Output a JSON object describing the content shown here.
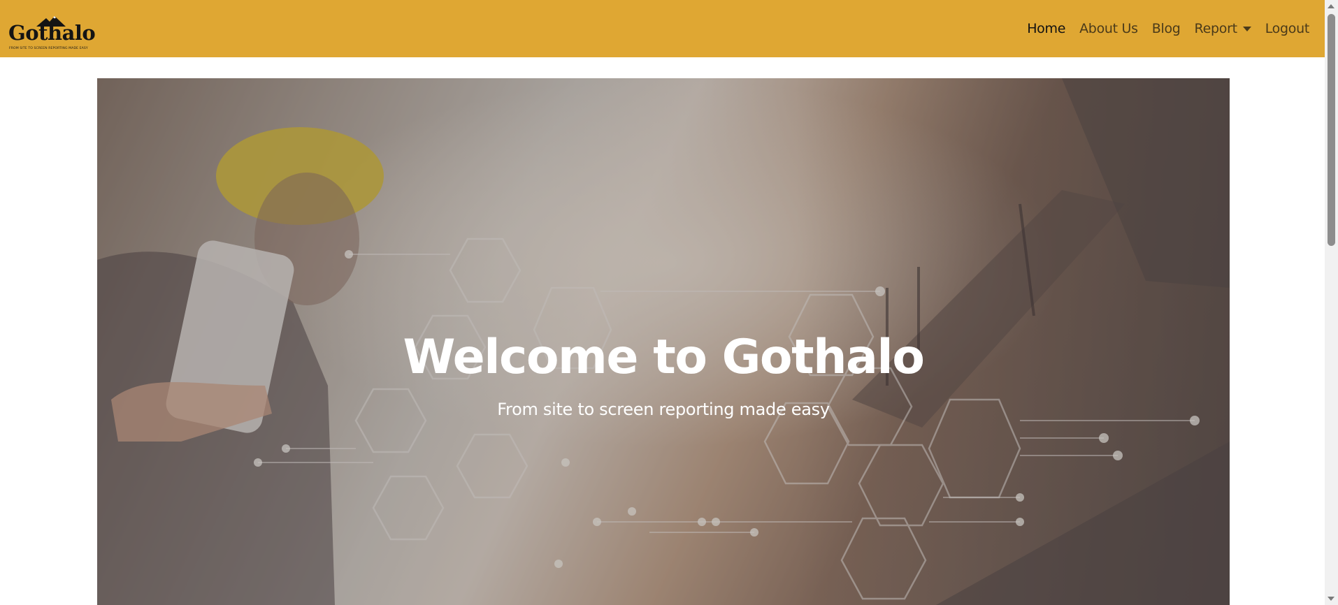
{
  "brand": {
    "name": "Gothalo",
    "tagline": "FROM SITE TO SCREEN REPORTING MADE EASY",
    "icon": "mountain-icon"
  },
  "nav": {
    "items": [
      {
        "label": "Home",
        "active": true
      },
      {
        "label": "About Us"
      },
      {
        "label": "Blog"
      },
      {
        "label": "Report",
        "dropdown": true
      },
      {
        "label": "Logout"
      }
    ]
  },
  "hero": {
    "title": "Welcome to Gothalo",
    "subtitle": "From site to screen reporting made easy"
  },
  "colors": {
    "navbar": "#dfa733",
    "hero_text": "#ffffff"
  }
}
